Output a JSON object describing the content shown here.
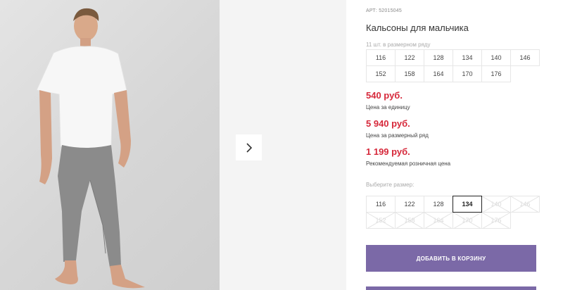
{
  "product": {
    "sku_label": "АРТ:",
    "sku_value": "52015045",
    "title": "Кальсоны для мальчика",
    "row_count": "11 шт. в размерном ряду"
  },
  "size_row": [
    "116",
    "122",
    "128",
    "134",
    "140",
    "146",
    "152",
    "158",
    "164",
    "170",
    "176"
  ],
  "prices": [
    {
      "value": "540 руб.",
      "label": "Цена за единицу"
    },
    {
      "value": "5 940 руб.",
      "label": "Цена за размерный ряд"
    },
    {
      "value": "1 199 руб.",
      "label": "Рекомендуемая розничная цена"
    }
  ],
  "size_select": {
    "label": "Выберите размер:",
    "selected": "134",
    "options": [
      {
        "size": "116",
        "available": true
      },
      {
        "size": "122",
        "available": true
      },
      {
        "size": "128",
        "available": true
      },
      {
        "size": "134",
        "available": true
      },
      {
        "size": "140",
        "available": false
      },
      {
        "size": "146",
        "available": false
      },
      {
        "size": "152",
        "available": false
      },
      {
        "size": "158",
        "available": false
      },
      {
        "size": "164",
        "available": false
      },
      {
        "size": "170",
        "available": false
      },
      {
        "size": "176",
        "available": false
      }
    ]
  },
  "actions": {
    "add_to_cart": "ДОБАВИТЬ В КОРЗИНУ"
  },
  "icons": {
    "next": "chevron-right-icon"
  },
  "colors": {
    "price": "#d6283a",
    "button": "#7b69a7"
  }
}
